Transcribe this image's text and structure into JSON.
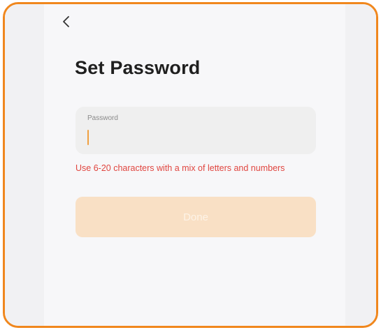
{
  "header": {
    "back_icon": "chevron-left-icon"
  },
  "page": {
    "title": "Set Password"
  },
  "password": {
    "label": "Password",
    "value": "",
    "placeholder": ""
  },
  "hint": {
    "text": "Use 6-20 characters with a mix of letters and numbers"
  },
  "actions": {
    "done_label": "Done"
  },
  "colors": {
    "accent": "#f0871d",
    "error": "#e0453f",
    "button_disabled_bg": "#f9e0c5",
    "field_bg": "#efefef"
  }
}
